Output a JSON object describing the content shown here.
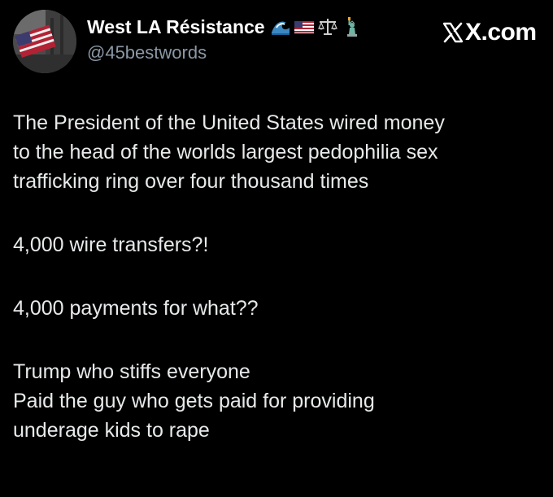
{
  "post": {
    "author": {
      "display_name": "West LA Résistance",
      "handle": "@45bestwords",
      "name_emojis": [
        "ocean-wave-icon",
        "us-flag-icon",
        "balance-scale-icon",
        "statue-of-liberty-icon"
      ]
    },
    "source": {
      "label": "X.com",
      "icon": "x-logo-icon"
    },
    "body": {
      "paragraph_1": {
        "line_1": "The President of the United States wired money",
        "line_2": "to the head of the worlds largest pedophilia sex",
        "line_3": "trafficking ring over four thousand times"
      },
      "paragraph_2": {
        "line_1": "4,000 wire transfers?!"
      },
      "paragraph_3": {
        "line_1": "4,000 payments for what??"
      },
      "paragraph_4": {
        "line_1": "Trump who stiffs everyone",
        "line_2": "Paid the guy who gets paid for providing",
        "line_3": "underage kids to rape"
      }
    }
  },
  "colors": {
    "background": "#000000",
    "primary_text": "#e7e9ea",
    "secondary_text": "#8b98a5",
    "heading_text": "#ffffff"
  }
}
